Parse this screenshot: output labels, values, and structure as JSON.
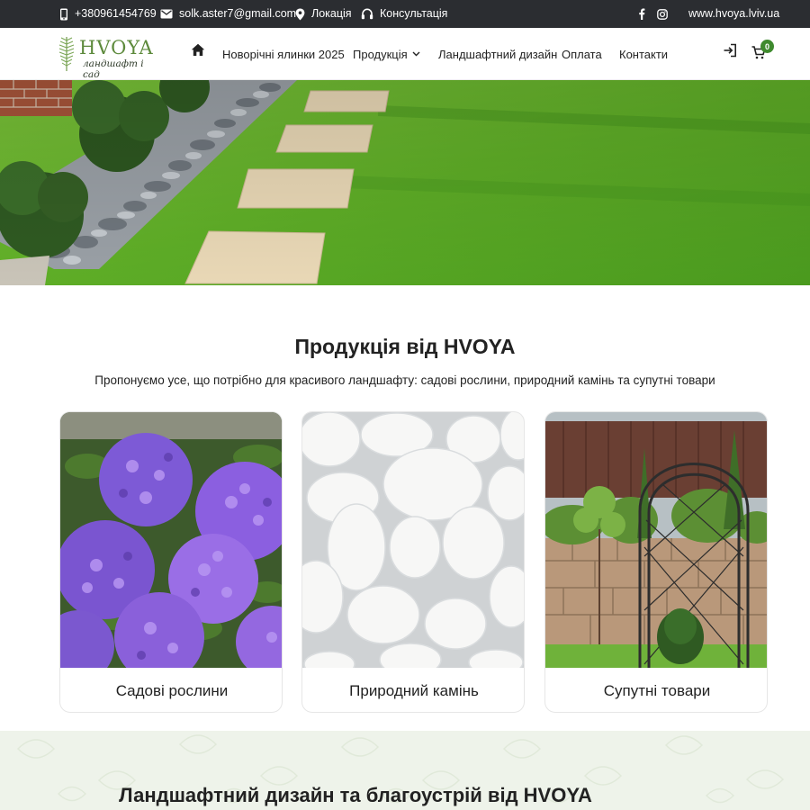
{
  "topbar": {
    "phone": "+380961454769",
    "email": "solk.aster7@gmail.com",
    "location": "Локація",
    "consult": "Консультація",
    "site": "www.hvoya.lviv.ua",
    "icons": [
      "phone-icon",
      "mail-icon",
      "location-pin-icon",
      "headset-icon",
      "facebook-icon",
      "instagram-icon"
    ]
  },
  "logo": {
    "word": "HVOYA",
    "sub": "ландшафт і сад"
  },
  "nav": {
    "items": [
      {
        "label": "Новорічні ялинки 2025"
      },
      {
        "label": "Продукція"
      },
      {
        "label": "Ландшафтний дизайн"
      },
      {
        "label": "Оплата"
      },
      {
        "label": "Контакти"
      }
    ],
    "cart_count": "0",
    "icons": [
      "home-icon",
      "chevron-down-icon",
      "login-icon",
      "cart-icon"
    ]
  },
  "hero": {
    "slides": 8,
    "active_slide": 5
  },
  "products": {
    "title_prefix": "Продукція від",
    "title_brand": "HVOYA",
    "subtitle": "Пропонуємо усе, що потрібно для красивого ландшафту: садові рослини, природний камінь та супутні товари",
    "cards": [
      {
        "label": "Садові рослини"
      },
      {
        "label": "Природний камінь"
      },
      {
        "label": "Супутні товари"
      }
    ]
  },
  "landscape": {
    "title_prefix": "Ландшафтний дизайн та благоустрій від",
    "title_brand": "HVOYA"
  },
  "colors": {
    "topbar_bg": "#2b2d31",
    "accent_green": "#3f8a2e",
    "section_bg": "#eef3ea"
  }
}
